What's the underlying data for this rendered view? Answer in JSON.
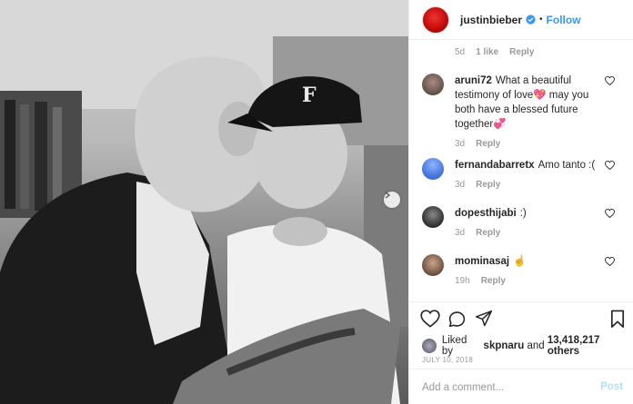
{
  "header": {
    "username": "justinbieber",
    "dot": "•",
    "follow_label": "Follow"
  },
  "caption_meta": {
    "time": "5d",
    "likes": "1 like",
    "reply": "Reply"
  },
  "comments": [
    {
      "user": "aruni72",
      "text": "What a beautiful testimony of love💖 may you both have a blessed future together💞",
      "time": "3d",
      "reply": "Reply",
      "avatar_color": "#6b5a4e"
    },
    {
      "user": "fernandabarretx",
      "text": "Amo tanto :(",
      "time": "3d",
      "reply": "Reply",
      "avatar_color": "#3f6fd6"
    },
    {
      "user": "dopesthijabi",
      "text": ":)",
      "time": "3d",
      "reply": "Reply",
      "avatar_color": "#3a3a3a"
    },
    {
      "user": "mominasaj",
      "text": "☝",
      "time": "19h",
      "reply": "Reply",
      "avatar_color": "#7a5a48"
    }
  ],
  "likes": {
    "prefix": "Liked by",
    "user": "skpnaru",
    "and": "and",
    "others": "13,418,217 others"
  },
  "date": "JULY 10, 2018",
  "add_comment": {
    "placeholder": "Add a comment...",
    "post_label": "Post"
  },
  "colors": {
    "link_blue": "#3897f0",
    "post_disabled": "#b2dffc",
    "meta_grey": "#999999"
  }
}
